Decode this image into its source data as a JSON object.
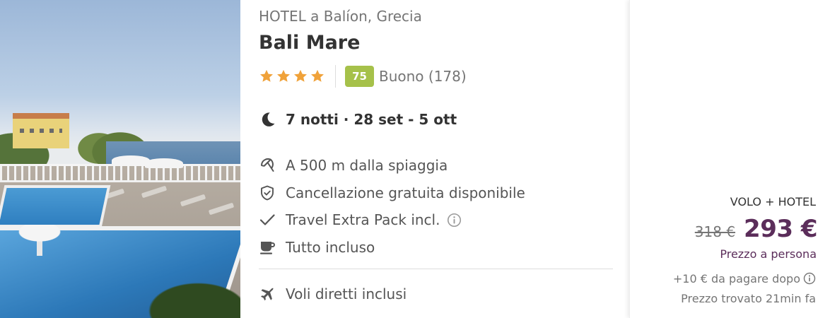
{
  "hotel": {
    "location": "HOTEL a Balíon, Grecia",
    "name": "Bali Mare",
    "stars": 4,
    "score": "75",
    "score_label": "Buono (178)"
  },
  "stay": {
    "summary": "7 notti · 28 set - 5 ott",
    "icon": "moon-icon"
  },
  "features": [
    {
      "icon": "beach-umbrella-icon",
      "label": "A 500 m dalla spiaggia"
    },
    {
      "icon": "shield-check-icon",
      "label": "Cancellazione gratuita disponibile"
    },
    {
      "icon": "checkmark-icon",
      "label": "Travel Extra Pack incl.",
      "info": true
    },
    {
      "icon": "coffee-cup-icon",
      "label": "Tutto incluso"
    }
  ],
  "flights": {
    "icon": "airplane-icon",
    "label": "Voli diretti inclusi"
  },
  "price": {
    "package_type": "VOLO + HOTEL",
    "old_price": "318 €",
    "new_price": "293 €",
    "per_person": "Prezzo a persona",
    "extra_fee": "+10 € da pagare dopo",
    "found_time": "Prezzo trovato 21min fa"
  },
  "colors": {
    "star": "#f0a23a",
    "score_badge": "#a6c14a",
    "price_accent": "#5b2d5a",
    "muted_text": "#757575"
  }
}
